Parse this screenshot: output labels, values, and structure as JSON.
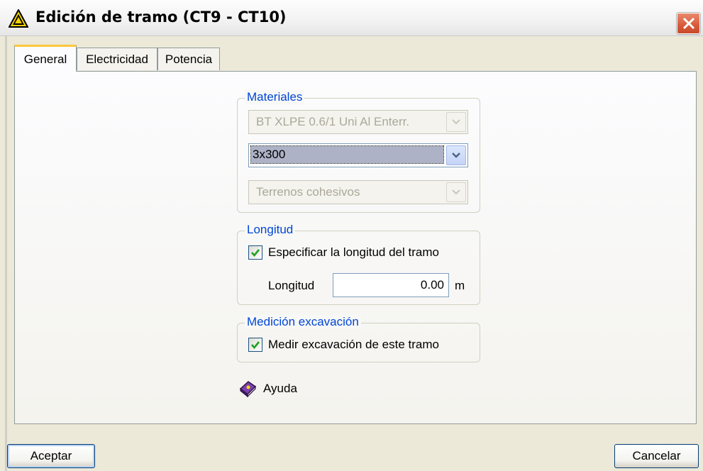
{
  "window": {
    "title": "Edición de tramo (CT9 - CT10)",
    "icon": "warning-triangle-icon",
    "close_icon": "close-icon"
  },
  "tabs": [
    {
      "label": "General",
      "active": true
    },
    {
      "label": "Electricidad",
      "active": false
    },
    {
      "label": "Potencia",
      "active": false
    }
  ],
  "materiales": {
    "label": "Materiales",
    "cable_type": "BT XLPE 0.6/1 Uni Al Enterr.",
    "section": "3x300",
    "terrain": "Terrenos cohesivos"
  },
  "longitud": {
    "label": "Longitud",
    "specify_checkbox_label": "Especificar la longitud del tramo",
    "specify_checked": true,
    "field_label": "Longitud",
    "value": "0.00",
    "unit": "m"
  },
  "excavacion": {
    "label": "Medición excavación",
    "measure_checkbox_label": "Medir excavación de este tramo",
    "measure_checked": true
  },
  "help": {
    "label": "Ayuda",
    "icon": "help-book-icon"
  },
  "buttons": {
    "ok": "Aceptar",
    "cancel": "Cancelar"
  },
  "colors": {
    "group_label": "#0046d5",
    "close_button": "#d85a3a",
    "tab_highlight": "#ffc83c"
  }
}
